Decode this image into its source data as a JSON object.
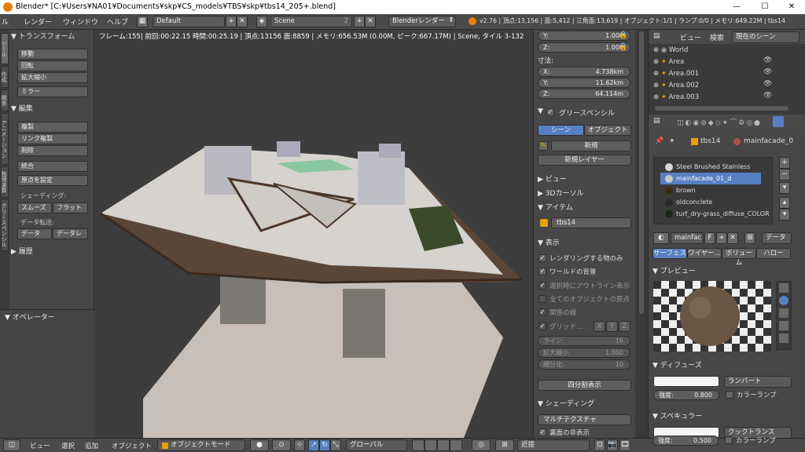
{
  "window": {
    "title": "Blender* [C:¥Users¥NA01¥Documents¥skp¥CS_models¥TBS¥skp¥tbs14_205+.blend]",
    "minimize": "—",
    "maximize": "☐",
    "close": "✕"
  },
  "infobar": {
    "menus": [
      "ル",
      "レンダー",
      "ウィンドウ",
      "ヘルプ"
    ],
    "layout": "Default",
    "scene": "Scene",
    "scene_count": "2",
    "engine": "Blenderレンダー",
    "stats": "v2.76 | 頂点:13,156 | 面:5,412 | 三角面:13,619 | オブジェクト:1/1 | ランプ:0/0 | メモリ:649.22M | tbs14"
  },
  "toolshelf": {
    "tabs": [
      "ツール",
      "作成",
      "関係",
      "アニメーション",
      "物理演算",
      "グリースペンシル"
    ],
    "transform_header": "▼ トランスフォーム",
    "transform_buttons": [
      "移動",
      "回転",
      "拡大縮小",
      "ミラー"
    ],
    "edit_header": "▼ 編集",
    "edit_buttons": [
      "複製",
      "リンク複製",
      "削除",
      "統合"
    ],
    "origin": "原点を設定",
    "shading_label": "シェーディング:",
    "smooth": "スムーズ",
    "flat": "フラット",
    "data_transfer_label": "データ転送:",
    "data": "データ",
    "data_l": "データレ",
    "history": "▶ 履歴",
    "operator": "▼ オペレーター"
  },
  "viewport": {
    "info": "フレーム:155| 前回:00:22.15 時間:00:25.19 | 頂点:13156 面:8859 | メモリ:656.53M (0.00M, ピーク:667.17M) | Scene, タイル 3-132"
  },
  "npanel": {
    "y_rot_label": "Y:",
    "y_rot_value": "1.000",
    "z_rot_label": "Z:",
    "z_rot_value": "1.000",
    "dimensions_header": "寸法:",
    "dim_x_label": "X:",
    "dim_x": "4.738km",
    "dim_y_label": "Y:",
    "dim_y": "11.62km",
    "dim_z_label": "Z:",
    "dim_z": "64.114m",
    "grease_header": "グリースペンシル",
    "scene_tab": "シーン",
    "object_tab": "オブジェクト",
    "new": "新規",
    "new_layer": "新規レイヤー",
    "view_header": "▶ ビュー",
    "cursor_header": "▶ 3Dカーソル",
    "item_header": "▼ アイテム",
    "item_name": "tbs14",
    "display_header": "▼ 表示",
    "display_opts": [
      "レンダリングする物のみ",
      "ワールドの背景",
      "選択時にアウトライン表示",
      "全てのオブジェクトの原点",
      "関係の線",
      "グリッド..."
    ],
    "grid_x": "X",
    "grid_y": "Y",
    "grid_z": "Z",
    "lines_label": "ライン:",
    "lines_value": "16",
    "scale_label": "拡大縮小:",
    "scale_value": "1.000",
    "subdiv_label": "細分化:",
    "subdiv_value": "10",
    "quad_view": "四分割表示",
    "shading_header": "▼ シェーディング",
    "shading_mode": "マルチテクスチャ",
    "backface": "裏面の非表示"
  },
  "outliner": {
    "view": "ビュー",
    "search": "検索",
    "scope": "現在のシーン",
    "rows": [
      "World",
      "Area",
      "Area.001",
      "Area.002",
      "Area.003"
    ]
  },
  "props": {
    "breadcrumb_obj": "tbs14",
    "breadcrumb_mat": "mainfacade_0",
    "slots": [
      {
        "name": "Steel Brushed Stainless",
        "color": "#d8d8d8"
      },
      {
        "name": "mainfacade_01_d",
        "color": "#c8c8c8"
      },
      {
        "name": "brown",
        "color": "#3a2a1a"
      },
      {
        "name": "oldconclete",
        "color": "#2a2a2a"
      },
      {
        "name": "turf_dry-grass_diffuse_COLOR",
        "color": "#1e2a18"
      }
    ],
    "mat_name": "mainfac",
    "f_label": "F",
    "data_dropdown": "データ",
    "tabs": [
      "サーフェス",
      "ワイヤー...",
      "ボリューム",
      "ハロー"
    ],
    "preview_header": "▼ プレビュー",
    "diffuse_header": "▼ ディフューズ",
    "diffuse_shader": "ランバート",
    "intensity_label": "強度:",
    "diffuse_intensity": "0.800",
    "ramp": "カラーランプ",
    "specular_header": "▼ スペキュラー",
    "specular_shader": "クックトランス",
    "specular_intensity": "0.500"
  },
  "bottombar": {
    "menus": [
      "ビュー",
      "選択",
      "追加",
      "オブジェクト"
    ],
    "mode": "オブジェクトモード",
    "orientation": "グローバル",
    "snap": "近接"
  },
  "colors": {
    "selected": "#5680c2",
    "accent_orange": "#e8a000"
  }
}
